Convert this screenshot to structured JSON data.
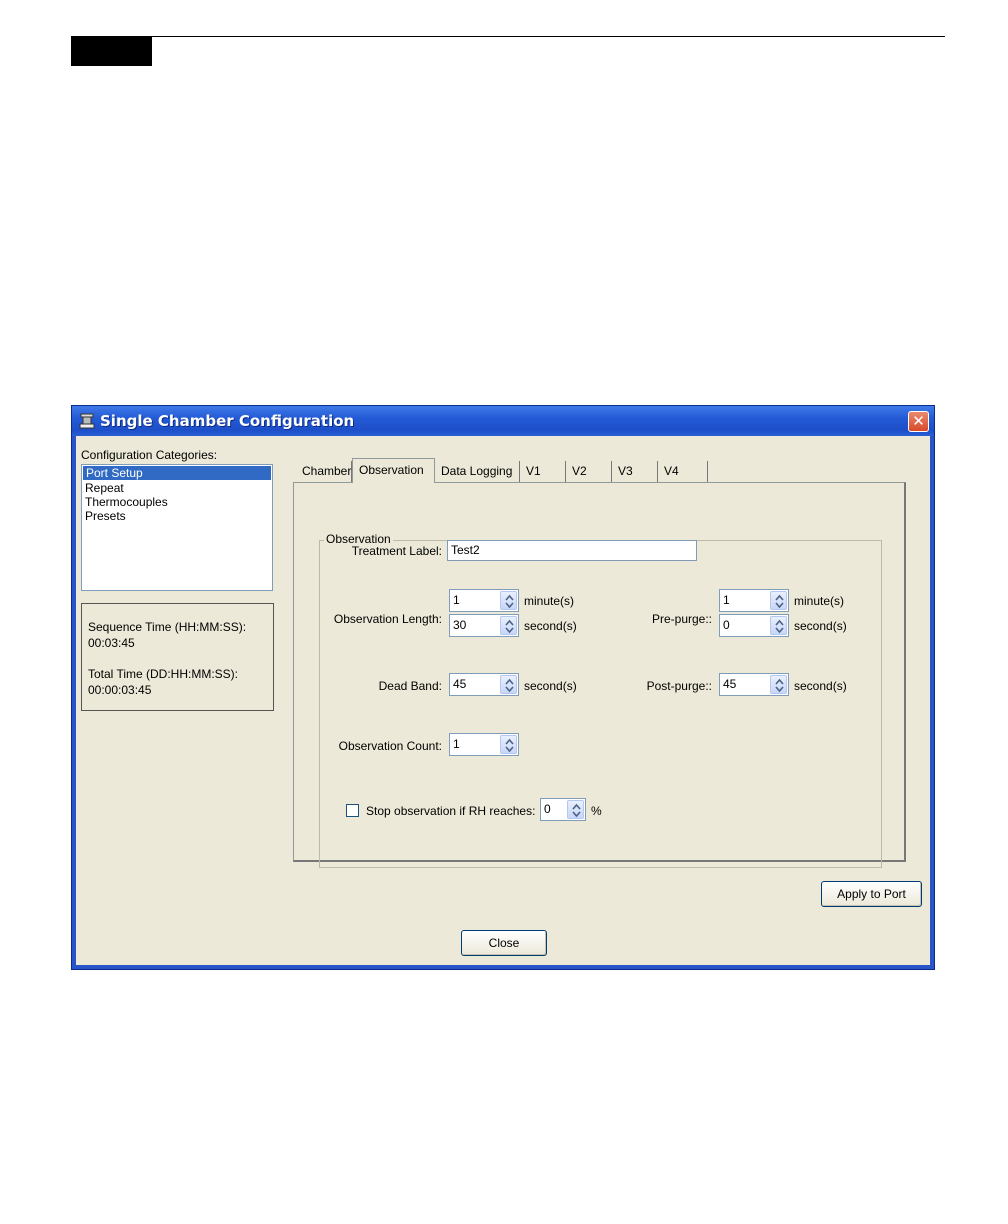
{
  "window": {
    "title": "Single Chamber Configuration",
    "close_glyph": "✕",
    "title_icon": "chamber-app-icon"
  },
  "sidebar": {
    "categories_label": "Configuration Categories:",
    "items": [
      {
        "label": "Port Setup",
        "selected": true
      },
      {
        "label": "Repeat"
      },
      {
        "label": "Thermocouples"
      },
      {
        "label": "Presets"
      }
    ],
    "sequence_time_label": "Sequence Time (HH:MM:SS):",
    "sequence_time_value": "00:03:45",
    "total_time_label": "Total Time (DD:HH:MM:SS):",
    "total_time_value": "00:00:03:45"
  },
  "tabs": [
    {
      "label": "Chamber"
    },
    {
      "label": "Observation",
      "active": true
    },
    {
      "label": "Data Logging"
    },
    {
      "label": "V1"
    },
    {
      "label": "V2"
    },
    {
      "label": "V3"
    },
    {
      "label": "V4"
    }
  ],
  "observation": {
    "group_title": "Observation",
    "treatment_label": "Treatment Label:",
    "treatment_value": "Test2",
    "obs_length_label": "Observation Length:",
    "obs_length_minutes": "1",
    "obs_length_seconds": "30",
    "minutes_unit": "minute(s)",
    "seconds_unit": "second(s)",
    "prepurge_label": "Pre-purge::",
    "prepurge_minutes": "1",
    "prepurge_seconds": "0",
    "dead_band_label": "Dead Band:",
    "dead_band_value": "45",
    "postpurge_label": "Post-purge::",
    "postpurge_value": "45",
    "obs_count_label": "Observation Count:",
    "obs_count_value": "1",
    "stop_rh_label": "Stop observation if RH reaches:",
    "stop_rh_checked": false,
    "stop_rh_value": "0",
    "percent_unit": "%"
  },
  "buttons": {
    "apply": "Apply to Port",
    "close": "Close"
  },
  "colors": {
    "titlebar": "#245ad6",
    "client_bg": "#ece9d8",
    "selection": "#316ac5",
    "close_button": "#d8492a"
  }
}
